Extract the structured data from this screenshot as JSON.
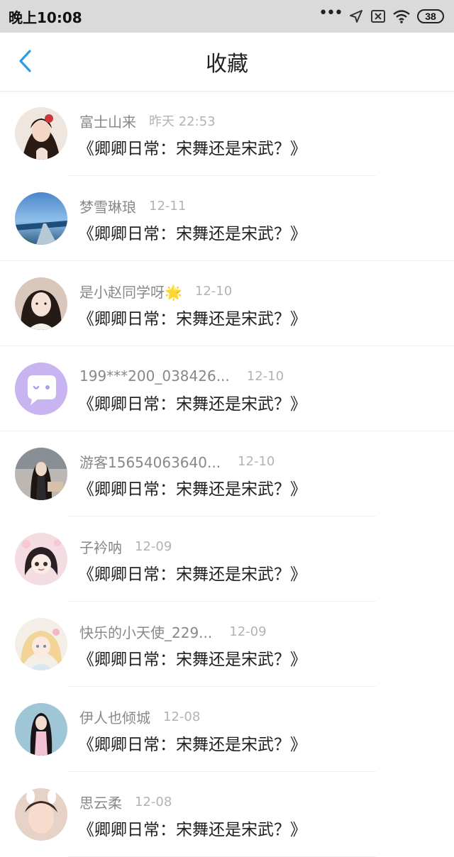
{
  "status_bar": {
    "time": "晚上10:08",
    "battery": "38"
  },
  "header": {
    "title": "收藏"
  },
  "favorites": [
    {
      "user": "富士山来",
      "time": "昨天 22:53",
      "title": "《卿卿日常：宋舞还是宋武？》",
      "time_gap": 18
    },
    {
      "user": "梦雪琳琅",
      "time": "12-11",
      "title": "《卿卿日常：宋舞还是宋武？》",
      "time_gap": 18
    },
    {
      "user": "是小赵同学呀🌟",
      "time": "12-10",
      "title": "《卿卿日常：宋舞还是宋武？》",
      "time_gap": 18
    },
    {
      "user": "199***200_038426...",
      "time": "12-10",
      "title": "《卿卿日常：宋舞还是宋武？》",
      "time_gap": 24
    },
    {
      "user": "游客15654063640...",
      "time": "12-10",
      "title": "《卿卿日常：宋舞还是宋武？》",
      "time_gap": 24
    },
    {
      "user": "子衿呐",
      "time": "12-09",
      "title": "《卿卿日常：宋舞还是宋武？》",
      "time_gap": 18
    },
    {
      "user": "快乐的小天使_229...",
      "time": "12-09",
      "title": "《卿卿日常：宋舞还是宋武？》",
      "time_gap": 24
    },
    {
      "user": "伊人也倾城",
      "time": "12-08",
      "title": "《卿卿日常：宋舞还是宋武？》",
      "time_gap": 18
    },
    {
      "user": "思云柔",
      "time": "12-08",
      "title": "《卿卿日常：宋舞还是宋武？》",
      "time_gap": 18
    }
  ],
  "icons": {
    "back": "chevron-left-icon",
    "signal": "location-arrow-icon",
    "sim": "no-sim-icon",
    "wifi": "wifi-icon"
  },
  "colors": {
    "accent": "#2f9be8",
    "status_bar_bg": "#dadada",
    "name_text": "#888888",
    "time_text": "#b3b3b3",
    "title_text": "#222222"
  }
}
